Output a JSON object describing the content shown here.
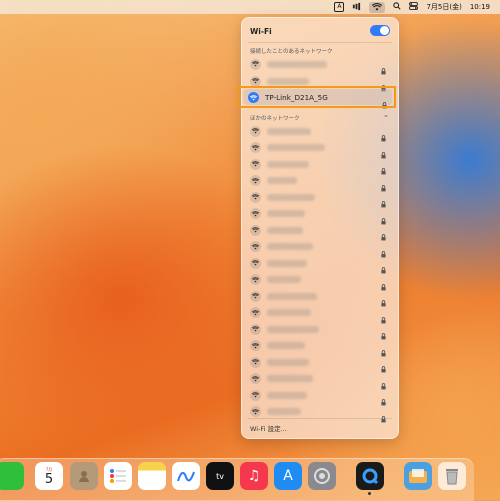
{
  "menubar": {
    "input_label": "A",
    "date": "7月5日(金)",
    "time": "10:19"
  },
  "wifi": {
    "title": "Wi-Fi",
    "toggle_on": true,
    "known_label": "接続したことのあるネットワーク",
    "other_label": "ほかのネットワーク",
    "selected_network": "TP-Link_D21A_5G",
    "settings_label": "Wi-Fi 設定..."
  },
  "dock": {
    "calendar_month": "7月",
    "calendar_day": "5",
    "tv_label": "tv"
  },
  "colors": {
    "accent": "#2f7cf6",
    "highlight": "#f39a1c"
  }
}
